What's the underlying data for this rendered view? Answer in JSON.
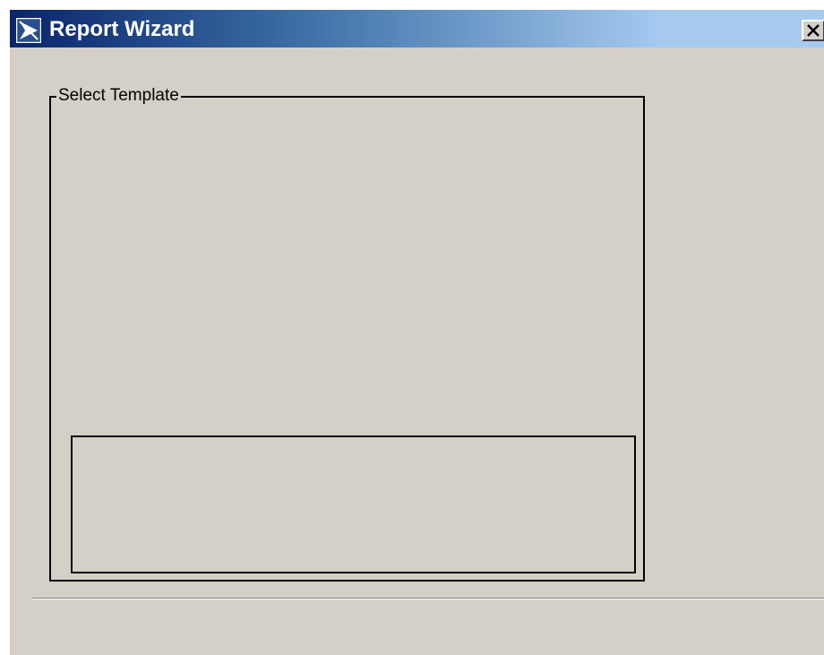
{
  "window": {
    "title": "Report Wizard",
    "icon": "report-wizard-app-icon",
    "close_icon": "close-icon"
  },
  "select_template": {
    "legend": "Select Template"
  },
  "colors": {
    "titlebar_start": "#0a246a",
    "titlebar_end": "#a6caf0",
    "window_bg": "#d4d0c8"
  }
}
